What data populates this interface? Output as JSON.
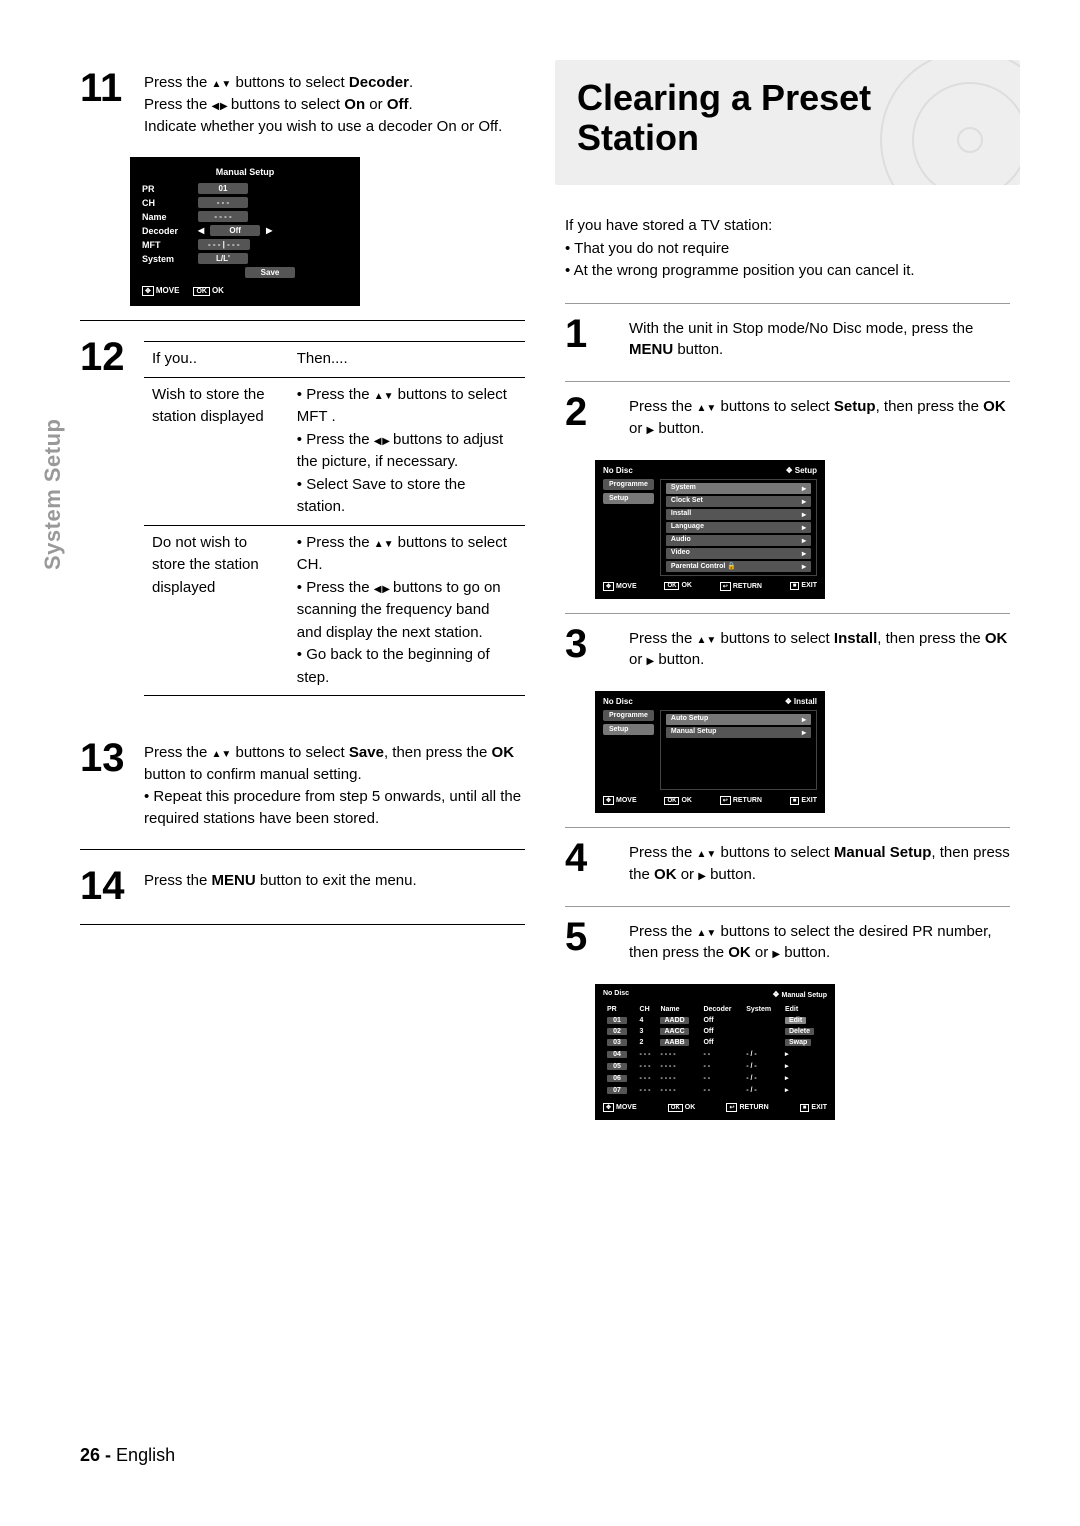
{
  "sideLabel": "System Setup",
  "left": {
    "step11": {
      "num": "11",
      "l1a": "Press the ",
      "l1b": " buttons to select ",
      "l1c": "Decoder",
      "l1d": ".",
      "l2a": "Press the ",
      "l2b": " buttons to select ",
      "l2c": "On",
      "l2d": " or ",
      "l2e": "Off",
      "l2f": ".",
      "l3": "Indicate whether you wish to use a decoder On or Off."
    },
    "osd1": {
      "title": "Manual Setup",
      "rows": [
        {
          "lbl": "PR",
          "val": "01"
        },
        {
          "lbl": "CH",
          "val": "- - -"
        },
        {
          "lbl": "Name",
          "val": "- - - -"
        },
        {
          "lbl": "Decoder",
          "val": "Off",
          "arrows": true
        },
        {
          "lbl": "MFT",
          "val": "- - - | - - -"
        },
        {
          "lbl": "System",
          "val": "L/L'"
        }
      ],
      "save": "Save",
      "footer": {
        "move": "MOVE",
        "ok": "OK"
      }
    },
    "step12": {
      "num": "12",
      "head1": "If you..",
      "head2": "Then....",
      "r1c1": "Wish to store the station displayed",
      "r1b1a": "Press the ",
      "r1b1b": " buttons to select MFT .",
      "r1b2a": "Press the ",
      "r1b2b": " buttons to adjust the picture, if necessary.",
      "r1b3": "Select Save to store the station.",
      "r2c1": "Do not wish to store the station displayed",
      "r2b1a": "Press the ",
      "r2b1b": " buttons to select CH.",
      "r2b2a": "Press the ",
      "r2b2b": " buttons to go on scanning the frequency band and display the next station.",
      "r2b3": "Go back to the beginning of step."
    },
    "step13": {
      "num": "13",
      "l1a": "Press the ",
      "l1b": " buttons to select ",
      "l1c": "Save",
      "l1d": ", then press the ",
      "l1e": "OK",
      "l1f": " button to confirm manual setting.",
      "bul": "Repeat this procedure from step 5 onwards, until all the required stations have been stored."
    },
    "step14": {
      "num": "14",
      "l1a": "Press the ",
      "l1b": "MENU",
      "l1c": " button to exit the menu."
    }
  },
  "right": {
    "title": "Clearing a Preset Station",
    "intro": "If you have stored a TV station:",
    "introB1": "That you do not require",
    "introB2": "At the wrong programme position you can cancel it.",
    "step1": {
      "num": "1",
      "a": "With the unit in Stop mode/No Disc mode, press the ",
      "b": "MENU",
      "c": " button."
    },
    "step2": {
      "num": "2",
      "a": "Press the ",
      "b": " buttons to select ",
      "c": "Setup",
      "d": ", then press the ",
      "e": "OK",
      "f": " or ",
      "g": " button."
    },
    "osd2": {
      "hdrL": "No Disc",
      "hdrR": "Setup",
      "tabs": [
        "Programme",
        "Setup"
      ],
      "rows": [
        "System",
        "Clock Set",
        "Install",
        "Language",
        "Audio",
        "Video",
        "Parental Control"
      ],
      "footer": {
        "move": "MOVE",
        "ok": "OK",
        "ret": "RETURN",
        "exit": "EXIT"
      }
    },
    "step3": {
      "num": "3",
      "a": "Press the ",
      "b": " buttons to select ",
      "c": "Install",
      "d": ", then press the ",
      "e": "OK",
      "f": " or ",
      "g": " button."
    },
    "osd3": {
      "hdrL": "No Disc",
      "hdrR": "Install",
      "tabs": [
        "Programme",
        "Setup"
      ],
      "rows": [
        "Auto Setup",
        "Manual Setup"
      ],
      "footer": {
        "move": "MOVE",
        "ok": "OK",
        "ret": "RETURN",
        "exit": "EXIT"
      }
    },
    "step4": {
      "num": "4",
      "a": "Press the ",
      "b": " buttons to select ",
      "c": "Manual Setup",
      "d": ", then press the ",
      "e": "OK",
      "f": " or ",
      "g": " button."
    },
    "step5": {
      "num": "5",
      "a": "Press the ",
      "b": " buttons to select the desired PR number, then press the ",
      "c": "OK",
      "d": " or ",
      "e": " button."
    },
    "osd4": {
      "hdrL": "No Disc",
      "hdrR": "Manual Setup",
      "cols": [
        "PR",
        "CH",
        "Name",
        "Decoder",
        "System",
        "Edit"
      ],
      "rows": [
        [
          "01",
          "4",
          "AADD",
          "Off",
          "",
          "Edit"
        ],
        [
          "02",
          "3",
          "AACC",
          "Off",
          "",
          "Delete"
        ],
        [
          "03",
          "2",
          "AABB",
          "Off",
          "",
          "Swap"
        ],
        [
          "04",
          "- - -",
          "- - - -",
          "- -",
          "- / -",
          "▸"
        ],
        [
          "05",
          "- - -",
          "- - - -",
          "- -",
          "- / -",
          "▸"
        ],
        [
          "06",
          "- - -",
          "- - - -",
          "- -",
          "- / -",
          "▸"
        ],
        [
          "07",
          "- - -",
          "- - - -",
          "- -",
          "- / -",
          "▸"
        ]
      ],
      "footer": {
        "move": "MOVE",
        "ok": "OK",
        "ret": "RETURN",
        "exit": "EXIT"
      }
    }
  },
  "footer": {
    "page": "26 -",
    "lang": "English"
  }
}
